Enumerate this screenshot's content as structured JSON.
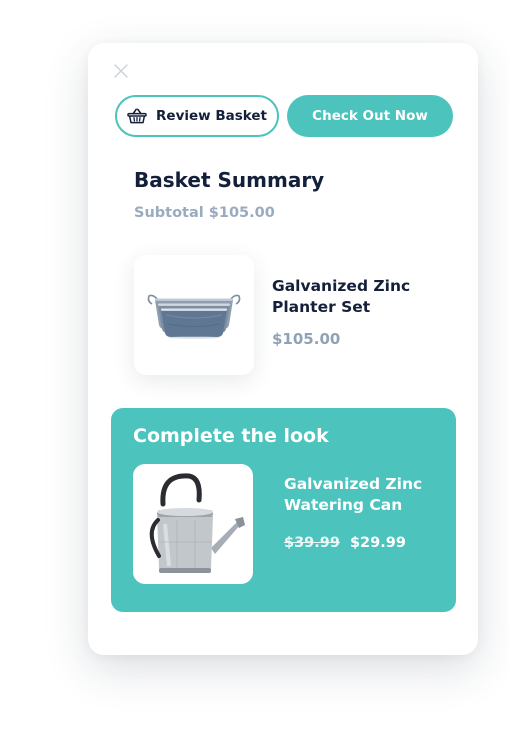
{
  "actions": {
    "review_basket_label": "Review Basket",
    "checkout_label": "Check Out Now"
  },
  "summary": {
    "title": "Basket Summary",
    "subtotal": "Subtotal $105.00"
  },
  "basket_items": [
    {
      "name": "Galvanized Zinc Planter Set",
      "price": "$105.00",
      "image": "planter-set-image"
    }
  ],
  "upsell": {
    "title": "Complete the look",
    "product": {
      "name": "Galvanized Zinc Watering Can",
      "original_price": "$39.99",
      "sale_price": "$29.99",
      "image": "watering-can-image"
    }
  },
  "icons": {
    "close": "close-icon",
    "basket": "basket-icon"
  },
  "colors": {
    "accent": "#4cc3bd",
    "heading": "#14203a",
    "muted": "#9aabbf",
    "surface": "#ffffff"
  }
}
